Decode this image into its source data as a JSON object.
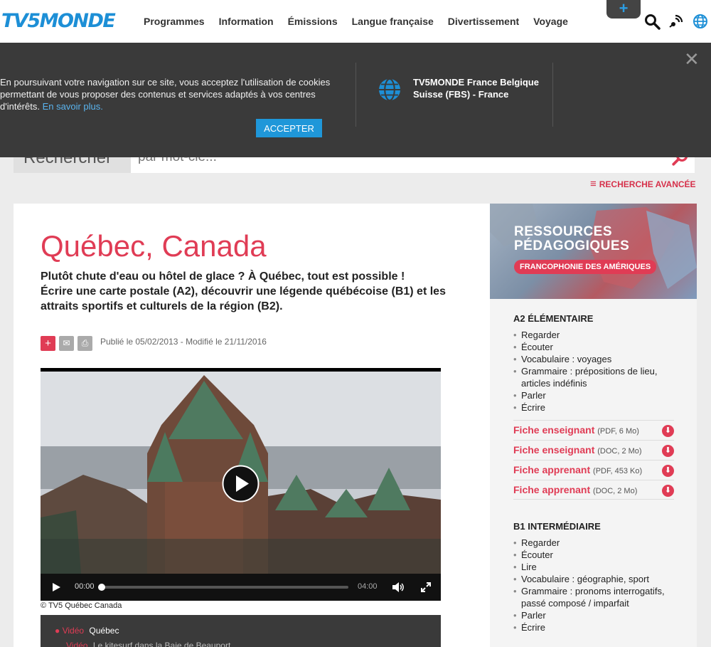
{
  "header": {
    "logo": "TV5MONDE",
    "nav": [
      "Programmes",
      "Information",
      "Émissions",
      "Langue française",
      "Divertissement",
      "Voyage"
    ],
    "plus_label": "+"
  },
  "cookie": {
    "text": "En poursuivant votre navigation sur ce site, vous acceptez l'utilisation de cookies permettant de vous proposer des contenus et services adaptés à vos centres d'intérêts.",
    "link": "En savoir plus.",
    "accept": "ACCEPTER",
    "country": "TV5MONDE France Belgique Suisse (FBS) - France",
    "close": "✕"
  },
  "search": {
    "label": "Rechercher",
    "placeholder": "par mot-clé...",
    "advanced": "RECHERCHE AVANCÉE"
  },
  "article": {
    "title": "Québec, Canada",
    "intro_line1": "Plutôt chute d'eau ou hôtel de glace ? À Québec, tout est possible !",
    "intro_line2": "Écrire une carte postale (A2), découvrir une légende québécoise (B1) et les attraits sportifs et culturels de la région (B2).",
    "published": "Publié le 05/02/2013 - Modifié le 21/11/2016",
    "credit": "© TV5 Québec Canada"
  },
  "player": {
    "current": "00:00",
    "duration": "04:00",
    "progress": 0
  },
  "playlist": [
    {
      "type": "Vidéo",
      "title": "Québec"
    },
    {
      "type": "Vidéo",
      "title": "Le kitesurf dans la Baie de Beauport"
    }
  ],
  "sidebar": {
    "banner_title_1": "RESSOURCES",
    "banner_title_2": "PÉDAGOGIQUES",
    "banner_tag": "FRANCOPHONIE DES AMÉRIQUES",
    "a2": {
      "heading": "A2 ÉLÉMENTAIRE",
      "skills": [
        "Regarder",
        "Écouter",
        "Vocabulaire : voyages",
        "Grammaire : prépositions de lieu, articles indéfinis",
        "Parler",
        "Écrire"
      ],
      "downloads": [
        {
          "label": "Fiche enseignant",
          "meta": "(PDF, 6 Mo)"
        },
        {
          "label": "Fiche enseignant",
          "meta": "(DOC, 2 Mo)"
        },
        {
          "label": "Fiche apprenant",
          "meta": "(PDF, 453 Ko)"
        },
        {
          "label": "Fiche apprenant",
          "meta": "(DOC, 2 Mo)"
        }
      ]
    },
    "b1": {
      "heading": "B1 INTERMÉDIAIRE",
      "skills": [
        "Regarder",
        "Écouter",
        "Lire",
        "Vocabulaire : géographie, sport",
        "Grammaire : pronoms interrogatifs, passé composé / imparfait",
        "Parler",
        "Écrire"
      ]
    }
  },
  "colors": {
    "accent": "#e03c55",
    "brand": "#1d8fd6",
    "banner_bg": "#3a3a3a"
  }
}
